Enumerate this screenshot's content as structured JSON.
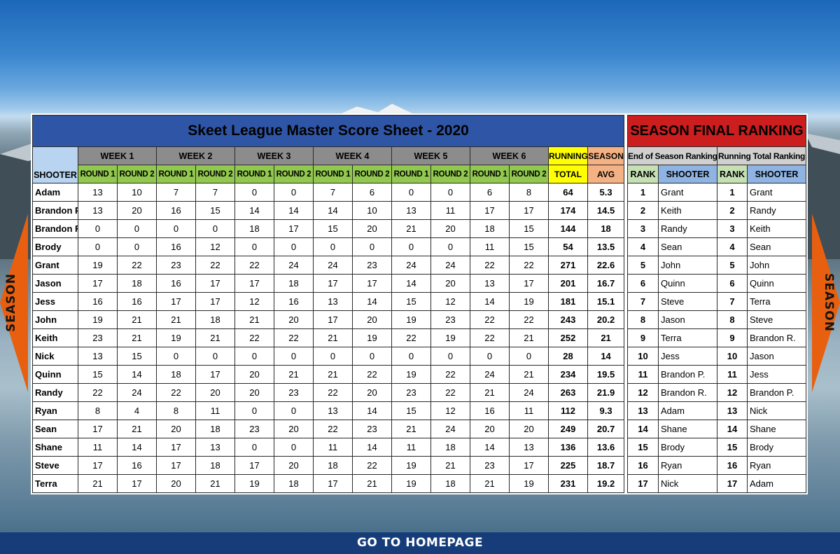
{
  "scoresheet": {
    "title": "Skeet League Master Score Sheet - 2020",
    "shooter_header": "SHOOTER",
    "weeks": [
      "WEEK 1",
      "WEEK 2",
      "WEEK 3",
      "WEEK 4",
      "WEEK 5",
      "WEEK 6"
    ],
    "round1_label": "ROUND 1",
    "round2_label": "ROUND 2",
    "running_label_1": "RUNNING",
    "running_label_2": "TOTAL",
    "avg_label_1": "SEASON",
    "avg_label_2": "AVG",
    "rows": [
      {
        "name": "Adam",
        "scores": [
          13,
          10,
          7,
          7,
          0,
          0,
          7,
          6,
          0,
          0,
          6,
          8
        ],
        "total": "64",
        "avg": "5.3"
      },
      {
        "name": "Brandon P.",
        "scores": [
          13,
          20,
          16,
          15,
          14,
          14,
          14,
          10,
          13,
          11,
          17,
          17
        ],
        "total": "174",
        "avg": "14.5"
      },
      {
        "name": "Brandon R.",
        "scores": [
          0,
          0,
          0,
          0,
          18,
          17,
          15,
          20,
          21,
          20,
          18,
          15
        ],
        "total": "144",
        "avg": "18"
      },
      {
        "name": "Brody",
        "scores": [
          0,
          0,
          16,
          12,
          0,
          0,
          0,
          0,
          0,
          0,
          11,
          15
        ],
        "total": "54",
        "avg": "13.5"
      },
      {
        "name": "Grant",
        "scores": [
          19,
          22,
          23,
          22,
          22,
          24,
          24,
          23,
          24,
          24,
          22,
          22
        ],
        "total": "271",
        "avg": "22.6"
      },
      {
        "name": "Jason",
        "scores": [
          17,
          18,
          16,
          17,
          17,
          18,
          17,
          17,
          14,
          20,
          13,
          17
        ],
        "total": "201",
        "avg": "16.7"
      },
      {
        "name": "Jess",
        "scores": [
          16,
          16,
          17,
          17,
          12,
          16,
          13,
          14,
          15,
          12,
          14,
          19
        ],
        "total": "181",
        "avg": "15.1"
      },
      {
        "name": "John",
        "scores": [
          19,
          21,
          21,
          18,
          21,
          20,
          17,
          20,
          19,
          23,
          22,
          22
        ],
        "total": "243",
        "avg": "20.2"
      },
      {
        "name": "Keith",
        "scores": [
          23,
          21,
          19,
          21,
          22,
          22,
          21,
          19,
          22,
          19,
          22,
          21
        ],
        "total": "252",
        "avg": "21"
      },
      {
        "name": "Nick",
        "scores": [
          13,
          15,
          0,
          0,
          0,
          0,
          0,
          0,
          0,
          0,
          0,
          0
        ],
        "total": "28",
        "avg": "14"
      },
      {
        "name": "Quinn",
        "scores": [
          15,
          14,
          18,
          17,
          20,
          21,
          21,
          22,
          19,
          22,
          24,
          21
        ],
        "total": "234",
        "avg": "19.5"
      },
      {
        "name": "Randy",
        "scores": [
          22,
          24,
          22,
          20,
          20,
          23,
          22,
          20,
          23,
          22,
          21,
          24
        ],
        "total": "263",
        "avg": "21.9"
      },
      {
        "name": "Ryan",
        "scores": [
          8,
          4,
          8,
          11,
          0,
          0,
          13,
          14,
          15,
          12,
          16,
          11
        ],
        "total": "112",
        "avg": "9.3"
      },
      {
        "name": "Sean",
        "scores": [
          17,
          21,
          20,
          18,
          23,
          20,
          22,
          23,
          21,
          24,
          20,
          20
        ],
        "total": "249",
        "avg": "20.7"
      },
      {
        "name": "Shane",
        "scores": [
          11,
          14,
          17,
          13,
          0,
          0,
          11,
          14,
          11,
          18,
          14,
          13
        ],
        "total": "136",
        "avg": "13.6"
      },
      {
        "name": "Steve",
        "scores": [
          17,
          16,
          17,
          18,
          17,
          20,
          18,
          22,
          19,
          21,
          23,
          17
        ],
        "total": "225",
        "avg": "18.7"
      },
      {
        "name": "Terra",
        "scores": [
          21,
          17,
          20,
          21,
          19,
          18,
          17,
          21,
          19,
          18,
          21,
          19
        ],
        "total": "231",
        "avg": "19.2"
      }
    ]
  },
  "ranking": {
    "title": "SEASON FINAL RANKING",
    "end_of_season_label": "End of Season Ranking",
    "running_total_label": "Running Total Ranking",
    "rank_label": "RANK",
    "shooter_label": "SHOOTER",
    "rows": [
      {
        "rank1": "1",
        "name1": "Grant",
        "rank2": "1",
        "name2": "Grant"
      },
      {
        "rank1": "2",
        "name1": "Keith",
        "rank2": "2",
        "name2": "Randy"
      },
      {
        "rank1": "3",
        "name1": "Randy",
        "rank2": "3",
        "name2": "Keith"
      },
      {
        "rank1": "4",
        "name1": "Sean",
        "rank2": "4",
        "name2": "Sean"
      },
      {
        "rank1": "5",
        "name1": "John",
        "rank2": "5",
        "name2": "John"
      },
      {
        "rank1": "6",
        "name1": "Quinn",
        "rank2": "6",
        "name2": "Quinn"
      },
      {
        "rank1": "7",
        "name1": "Steve",
        "rank2": "7",
        "name2": "Terra"
      },
      {
        "rank1": "8",
        "name1": "Jason",
        "rank2": "8",
        "name2": "Steve"
      },
      {
        "rank1": "9",
        "name1": "Terra",
        "rank2": "9",
        "name2": "Brandon R."
      },
      {
        "rank1": "10",
        "name1": "Jess",
        "rank2": "10",
        "name2": "Jason"
      },
      {
        "rank1": "11",
        "name1": "Brandon P.",
        "rank2": "11",
        "name2": "Jess"
      },
      {
        "rank1": "12",
        "name1": "Brandon R.",
        "rank2": "12",
        "name2": "Brandon P."
      },
      {
        "rank1": "13",
        "name1": "Adam",
        "rank2": "13",
        "name2": "Nick"
      },
      {
        "rank1": "14",
        "name1": "Shane",
        "rank2": "14",
        "name2": "Shane"
      },
      {
        "rank1": "15",
        "name1": "Brody",
        "rank2": "15",
        "name2": "Brody"
      },
      {
        "rank1": "16",
        "name1": "Ryan",
        "rank2": "16",
        "name2": "Ryan"
      },
      {
        "rank1": "17",
        "name1": "Nick",
        "rank2": "17",
        "name2": "Adam"
      }
    ]
  },
  "nav": {
    "left_arrow_label": "SEASON",
    "right_arrow_label": "SEASON",
    "homepage_label": "GO TO HOMEPAGE"
  },
  "colors": {
    "title_blue": "#2f56a6",
    "ranking_red": "#cc1e1e",
    "round_green": "#92c84f",
    "running_yellow": "#ffff00",
    "avg_orange": "#f4b183",
    "arrow_orange": "#e8600f",
    "footer_navy": "#163d7a"
  }
}
